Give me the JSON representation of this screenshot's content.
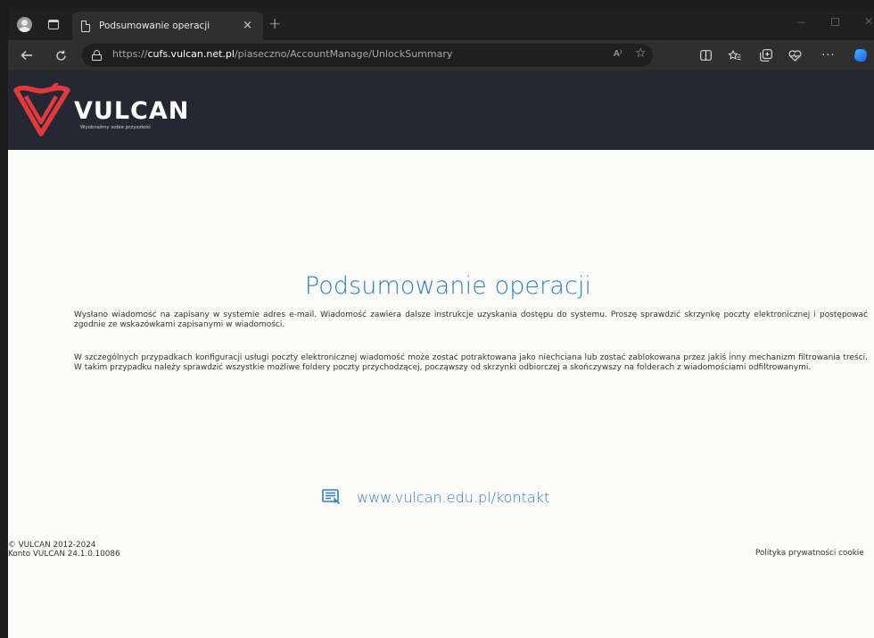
{
  "browser": {
    "tab_title": "Podsumowanie operacji",
    "tab_close": "×",
    "new_tab": "+",
    "url_prefix": "https://",
    "url_domain": "cufs.vulcan.net.pl",
    "url_path": "/piaseczno/AccountManage/UnlockSummary",
    "read_aloud_label": "A⁾",
    "window_controls": {
      "minimize": "—",
      "close": "✕"
    }
  },
  "header": {
    "brand": "VULCAN",
    "tagline": "Wyobraźmy sobie przyszłość",
    "colors": {
      "background": "#252733",
      "logo_red": "#e03a3e"
    }
  },
  "main": {
    "title": "Podsumowanie operacji",
    "paragraphs": [
      "Wysłano wiadomość na zapisany w systemie adres e-mail. Wiadomość zawiera dalsze instrukcje uzyskania dostępu do systemu. Proszę sprawdzić skrzynkę poczty elektronicznej i postępować zgodnie ze wskazówkami zapisanymi w wiadomości.",
      "W szczególnych przypadkach konfiguracji usługi poczty elektronicznej wiadomość może zostać potraktowana jako niechciana lub zostać zablokowana przez jakiś inny mechanizm filtrowania treści. W takim przypadku należy sprawdzić wszystkie możliwe foldery poczty przychodzącej, począwszy od skrzynki odbiorczej a skończywszy na folderach z wiadomościami odfiltrowanymi."
    ],
    "contact_link": "www.vulcan.edu.pl/kontakt",
    "colors": {
      "accent": "#2d7fc4"
    }
  },
  "footer": {
    "copyright": "© VULCAN 2012-2024",
    "version": "Konto VULCAN 24.1.0.10086",
    "privacy": "Polityka prywatności cookie"
  }
}
